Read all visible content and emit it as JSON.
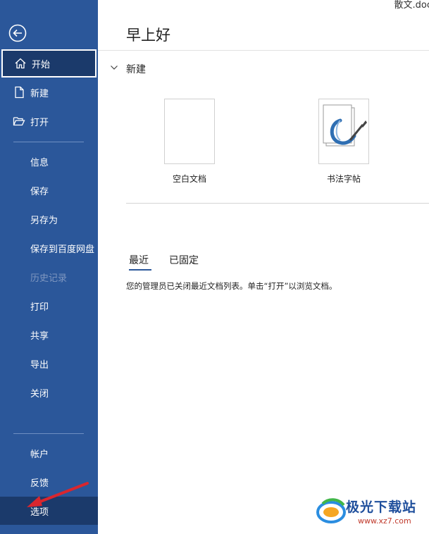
{
  "window": {
    "filename": "散文.doc"
  },
  "sidebar": {
    "items": [
      {
        "label": "开始",
        "icon": "home-icon"
      },
      {
        "label": "新建",
        "icon": "new-document-icon"
      },
      {
        "label": "打开",
        "icon": "open-folder-icon"
      },
      {
        "label": "信息"
      },
      {
        "label": "保存"
      },
      {
        "label": "另存为"
      },
      {
        "label": "保存到百度网盘"
      },
      {
        "label": "历史记录"
      },
      {
        "label": "打印"
      },
      {
        "label": "共享"
      },
      {
        "label": "导出"
      },
      {
        "label": "关闭"
      },
      {
        "label": "帐户"
      },
      {
        "label": "反馈"
      },
      {
        "label": "选项"
      }
    ]
  },
  "main": {
    "greeting": "早上好",
    "new_section": {
      "title": "新建",
      "templates": [
        {
          "name": "空白文档"
        },
        {
          "name": "书法字帖"
        }
      ]
    },
    "tabs": [
      {
        "label": "最近"
      },
      {
        "label": "已固定"
      }
    ],
    "notice": "您的管理员已关闭最近文档列表。单击“打开”以浏览文档。"
  },
  "watermark": {
    "brand": "极光下载站",
    "url": "www.xz7.com"
  },
  "colors": {
    "sidebar": "#2b579a",
    "sidebar_selected": "#1b3a6b",
    "arrow": "#d9262e"
  }
}
